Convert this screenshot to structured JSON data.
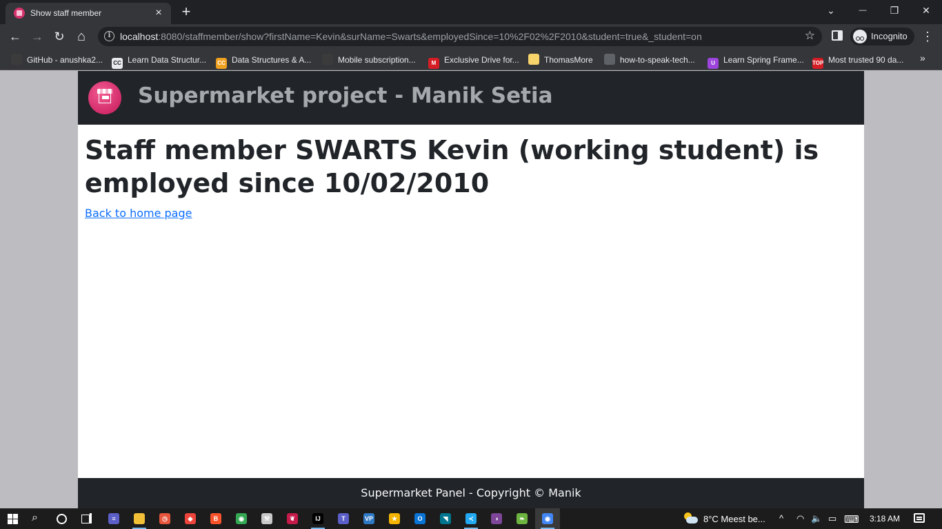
{
  "browser": {
    "tab": {
      "title": "Show staff member",
      "close_icon": "×"
    },
    "new_tab_icon": "+",
    "window_controls": {
      "tab_search": "⌄",
      "minimize": "—",
      "restore": "❐",
      "close": "✕"
    },
    "nav": {
      "back": "←",
      "forward": "→",
      "reload": "↻",
      "home": "⌂"
    },
    "address": {
      "host": "localhost",
      "rest": ":8080/staffmember/show?firstName=Kevin&surName=Swarts&employedSince=10%2F02%2F2010&student=true&_student=on",
      "info_icon": "i",
      "star_icon": "☆"
    },
    "profile_label": "Incognito",
    "menu_icon": "⋮",
    "bookmarks": [
      {
        "label": "GitHub - anushka2...",
        "icon_text": "",
        "icon_color": "#3b3b3b"
      },
      {
        "label": "Learn Data Structur...",
        "icon_text": "CC",
        "icon_color": "#e8eaed"
      },
      {
        "label": "Data Structures & A...",
        "icon_text": "CC",
        "icon_color": "#f0a020"
      },
      {
        "label": "Mobile subscription...",
        "icon_text": "",
        "icon_color": "#3b3b3b"
      },
      {
        "label": "Exclusive Drive for...",
        "icon_text": "M",
        "icon_color": "#d41d24"
      },
      {
        "label": "ThomasMore",
        "icon_text": "",
        "icon_color": "#f6d36b"
      },
      {
        "label": "how-to-speak-tech...",
        "icon_text": "",
        "icon_color": "#5f6368"
      },
      {
        "label": "Learn Spring Frame...",
        "icon_text": "U",
        "icon_color": "#9c44dc"
      },
      {
        "label": "Most trusted 90 da...",
        "icon_text": "TOP",
        "icon_color": "#d41d24"
      }
    ],
    "bookmarks_more_icon": "»"
  },
  "page": {
    "brand_title": "Supermarket project - Manik Setia",
    "heading": "Staff member SWARTS Kevin (working student) is employed since 10/02/2010",
    "home_link": "Back to home page",
    "footer": "Supermarket Panel - Copyright © Manik"
  },
  "taskbar": {
    "search_icon": "⌕",
    "apps": [
      {
        "name": "taskbar-app-terminal",
        "glyph": "≡",
        "color": "#5b5fc7",
        "running": false,
        "active": false
      },
      {
        "name": "taskbar-app-file-explorer",
        "glyph": "",
        "color": "#f2c037",
        "running": true,
        "active": false
      },
      {
        "name": "taskbar-app-clock",
        "glyph": "◷",
        "color": "#e8563d",
        "running": false,
        "active": false
      },
      {
        "name": "taskbar-app-anydesk",
        "glyph": "◆",
        "color": "#ef443b",
        "running": false,
        "active": false
      },
      {
        "name": "taskbar-app-brave",
        "glyph": "B",
        "color": "#fb542b",
        "running": false,
        "active": false
      },
      {
        "name": "taskbar-app-chrome",
        "glyph": "◉",
        "color": "#34a853",
        "running": false,
        "active": false
      },
      {
        "name": "taskbar-app-tool",
        "glyph": "⚒",
        "color": "#c9c9c9",
        "running": false,
        "active": false
      },
      {
        "name": "taskbar-app-raspberry",
        "glyph": "❦",
        "color": "#c51a4a",
        "running": false,
        "active": false
      },
      {
        "name": "taskbar-app-intellij",
        "glyph": "IJ",
        "color": "#000000",
        "running": true,
        "active": false
      },
      {
        "name": "taskbar-app-teams",
        "glyph": "T",
        "color": "#5b5fc7",
        "running": false,
        "active": false
      },
      {
        "name": "taskbar-app-visual-paradigm",
        "glyph": "VP",
        "color": "#2f78c4",
        "running": false,
        "active": false
      },
      {
        "name": "taskbar-app-star",
        "glyph": "★",
        "color": "#f4b400",
        "running": false,
        "active": false
      },
      {
        "name": "taskbar-app-outlook",
        "glyph": "O",
        "color": "#0a74d4",
        "running": false,
        "active": false
      },
      {
        "name": "taskbar-app-mysql",
        "glyph": "◥",
        "color": "#00758f",
        "running": false,
        "active": false
      },
      {
        "name": "taskbar-app-vscode",
        "glyph": "≺",
        "color": "#23a9f2",
        "running": true,
        "active": false
      },
      {
        "name": "taskbar-app-tor",
        "glyph": "◑",
        "color": "#7d4698",
        "running": false,
        "active": false
      },
      {
        "name": "taskbar-app-spring",
        "glyph": "❧",
        "color": "#6db33f",
        "running": false,
        "active": false
      },
      {
        "name": "taskbar-app-chrome-incognito",
        "glyph": "◉",
        "color": "#4285f4",
        "running": true,
        "active": true
      }
    ],
    "weather": "8°C  Meest be...",
    "tray": {
      "chevron": "^",
      "wifi": "◠",
      "volume": "🔈",
      "battery": "▭",
      "keyboard": "⌨"
    },
    "clock": "3:18 AM"
  }
}
